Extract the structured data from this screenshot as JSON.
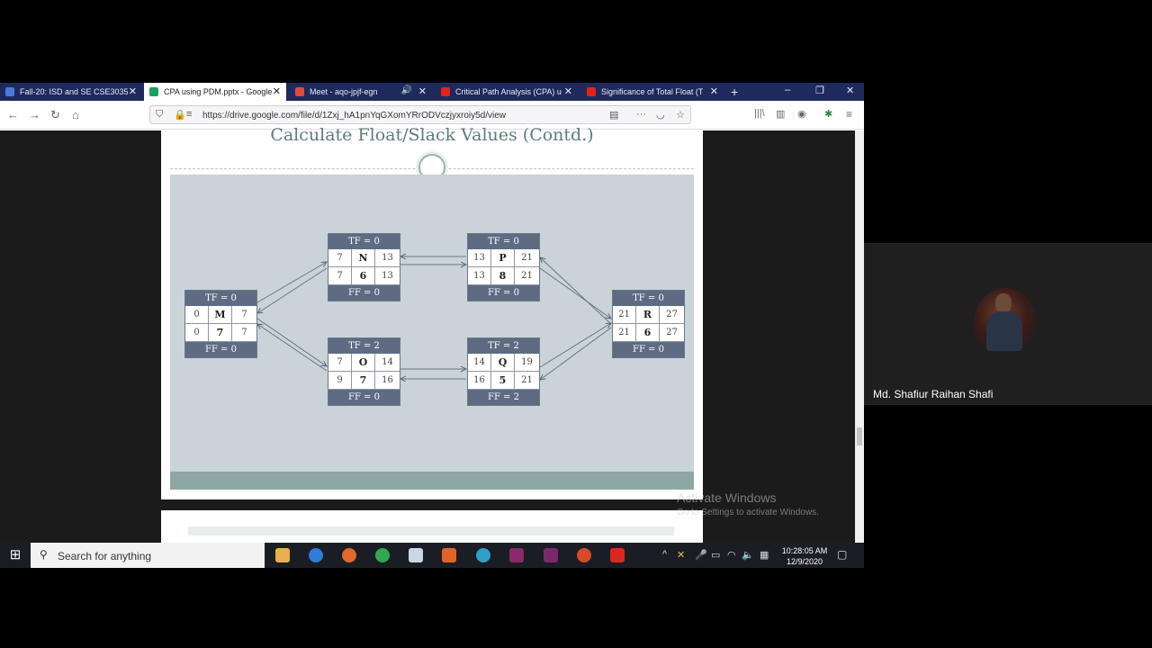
{
  "browser": {
    "tabs": [
      {
        "label": "Fall-20: ISD and SE CSE3035",
        "icon_color": "#4a7ad8",
        "active": false
      },
      {
        "label": "CPA using PDM.pptx - Google",
        "icon_color": "#1aa260",
        "active": true
      },
      {
        "label": "Meet - aqo-jpjf-egn",
        "icon_color": "#e04a3a",
        "active": false
      },
      {
        "label": "Critical Path Analysis (CPA) u",
        "icon_color": "#e62117",
        "active": false
      },
      {
        "label": "Significance of Total Float (T",
        "icon_color": "#e62117",
        "active": false
      }
    ],
    "new_tab": "+",
    "url": "https://drive.google.com/file/d/1Zxj_hA1pnYqGXomYRrODVczjyxroiy5d/view",
    "window_controls": {
      "minimize": "–",
      "restore": "❐",
      "close": "✕"
    }
  },
  "slide": {
    "title": "Calculate Float/Slack Values (Contd.)",
    "nodes": [
      {
        "id": "M",
        "tf": "TF = 0",
        "ff": "FF = 0",
        "es": "0",
        "ef": "7",
        "ls": "0",
        "dur": "7",
        "lf": "7"
      },
      {
        "id": "N",
        "tf": "TF = 0",
        "ff": "FF = 0",
        "es": "7",
        "ef": "13",
        "ls": "7",
        "dur": "6",
        "lf": "13"
      },
      {
        "id": "P",
        "tf": "TF = 0",
        "ff": "FF = 0",
        "es": "13",
        "ef": "21",
        "ls": "13",
        "dur": "8",
        "lf": "21"
      },
      {
        "id": "R",
        "tf": "TF = 0",
        "ff": "FF = 0",
        "es": "21",
        "ef": "27",
        "ls": "21",
        "dur": "6",
        "lf": "27"
      },
      {
        "id": "O",
        "tf": "TF = 2",
        "ff": "FF = 0",
        "es": "7",
        "ef": "14",
        "ls": "9",
        "dur": "7",
        "lf": "16"
      },
      {
        "id": "Q",
        "tf": "TF = 2",
        "ff": "FF = 2",
        "es": "14",
        "ef": "19",
        "ls": "16",
        "dur": "5",
        "lf": "21"
      }
    ]
  },
  "activation": {
    "title": "Activate Windows",
    "subtitle": "Go to Settings to activate Windows."
  },
  "taskbar": {
    "search_placeholder": "Search for anything",
    "time": "10:28:05 AM",
    "date": "12/9/2020",
    "pinned_colors": [
      "#e8b04a",
      "#2f7bd8",
      "#e06a2a",
      "#2fa84f",
      "#c9d7e6",
      "#e0642a",
      "#2fa0c9",
      "#8a2a6a",
      "#7a2a6a",
      "#d84a2a",
      "#d8281f"
    ]
  },
  "meet": {
    "participant_name": "Md. Shafiur Raihan Shafi"
  }
}
